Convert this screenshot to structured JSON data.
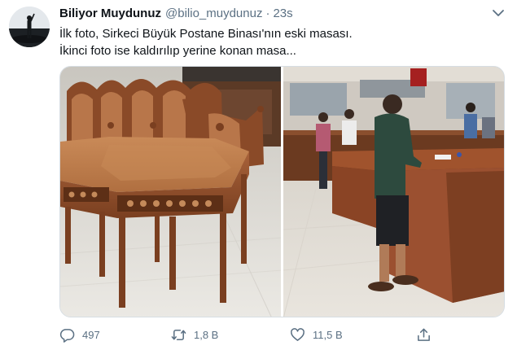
{
  "tweet": {
    "display_name": "Biliyor Muydunuz",
    "handle": "@bilio_muydunuz",
    "separator": "·",
    "time": "23s",
    "text_line1": "İlk foto, Sirkeci Büyük Postane Binası'nın eski masası.",
    "text_line2": "İkinci foto ise kaldırılıp yerine konan masa..."
  },
  "actions": {
    "reply_count": "497",
    "retweet_count": "1,8 B",
    "like_count": "11,5 B"
  },
  "colors": {
    "text_primary": "#0f1419",
    "text_secondary": "#5b7083",
    "border": "#d6dde3"
  },
  "icons": [
    "caret-down-icon",
    "reply-icon",
    "retweet-icon",
    "like-icon",
    "share-icon"
  ]
}
